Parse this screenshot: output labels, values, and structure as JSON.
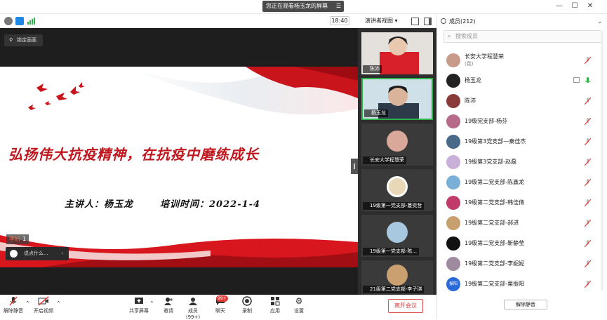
{
  "titlebar": {
    "banner": "您正在观看杨玉龙的屏幕",
    "menu_glyph": "☰",
    "min": "—",
    "max": "☐",
    "close": "✕"
  },
  "status": {
    "time": "18:40",
    "view": "演讲者视图"
  },
  "stage": {
    "pin_label": "锁定画面",
    "slide_title": "弘扬伟大抗疫精神，在抗疫中磨练成长",
    "slide_speaker": "主讲人：杨玉龙",
    "slide_date": "培训时间：2022-1-4",
    "speaker_name": "李妍",
    "speaker_count": "1",
    "chat_placeholder": "说点什么..."
  },
  "thumbs": [
    {
      "name": "陈沛"
    },
    {
      "name": "杨玉龙"
    },
    {
      "name": "长安大学程慧荣"
    },
    {
      "name": "19级第一党支部-蔓奕哲"
    },
    {
      "name": "19级第一党支部-陈..."
    },
    {
      "name": "21级第二党支部-李子琪"
    }
  ],
  "sidebar": {
    "title": "成员(212)",
    "search_placeholder": "搜索成员",
    "members": [
      {
        "name": "长安大学程慧荣",
        "sub": "(我)",
        "color": "#c89a8a",
        "mic": "muted"
      },
      {
        "name": "杨玉龙",
        "sub": "",
        "color": "#222",
        "mic": "active"
      },
      {
        "name": "陈沛",
        "sub": "",
        "color": "#8a3a3a",
        "mic": "muted"
      },
      {
        "name": "19级党支部-杨芬",
        "sub": "",
        "color": "#b86a8a",
        "mic": "muted"
      },
      {
        "name": "19级第3党支部—秦佳杰",
        "sub": "",
        "color": "#4a6a8a",
        "mic": "muted"
      },
      {
        "name": "19级第3党支部-赵磊",
        "sub": "",
        "color": "#c8b0d8",
        "mic": "muted"
      },
      {
        "name": "19级第二党支部-陈鑫龙",
        "sub": "",
        "color": "#7ab0d8",
        "mic": "muted"
      },
      {
        "name": "19级第二党支部-韩佳倩",
        "sub": "",
        "color": "#c03a6a",
        "mic": "muted"
      },
      {
        "name": "19级第二党支部-郝进",
        "sub": "",
        "color": "#c8a070",
        "mic": "muted"
      },
      {
        "name": "19级第二党支部-靳静莹",
        "sub": "",
        "color": "#111",
        "mic": "muted"
      },
      {
        "name": "19级第二党支部-李妮妮",
        "sub": "",
        "color": "#a08aa0",
        "mic": "muted"
      },
      {
        "name": "19级第二党支部-栗振阳",
        "sub": "",
        "color": "#2a6ad8",
        "mic": "muted",
        "avatar_text": "振阳"
      }
    ],
    "unmute_all": "解除静音"
  },
  "toolbar": {
    "mute": "解除静音",
    "video": "开启视频",
    "share": "共享屏幕",
    "invite": "邀请",
    "members": "成员(99+)",
    "chat": "聊天",
    "chat_badge": "99+",
    "record": "录制",
    "apps": "应用",
    "settings": "设置",
    "leave": "离开会议"
  },
  "colors": {
    "accent": "#1e88e5",
    "danger": "#e03a3a",
    "slide_red": "#c0161d"
  }
}
